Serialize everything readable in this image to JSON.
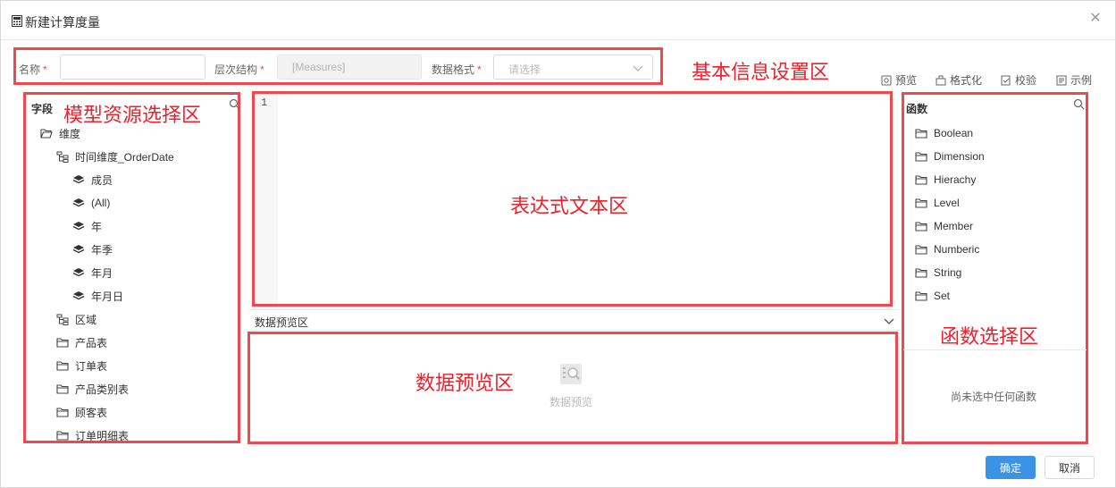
{
  "dialog": {
    "title": "新建计算度量",
    "close_symbol": "✕"
  },
  "form": {
    "name_label": "名称",
    "name_value": "",
    "hierarchy_label": "层次结构",
    "hierarchy_value": "[Measures]",
    "format_label": "数据格式",
    "format_placeholder": "请选择",
    "required_mark": "*"
  },
  "toolbar": {
    "preview": "预览",
    "format": "格式化",
    "validate": "校验",
    "example": "示例"
  },
  "fields": {
    "title": "字段",
    "dimension_folder": "维度",
    "time_dimension": "时间维度_OrderDate",
    "time_levels": [
      "成员",
      "(All)",
      "年",
      "年季",
      "年月",
      "年月日"
    ],
    "region": "区域",
    "tables": [
      "产品表",
      "订单表",
      "产品类别表",
      "顾客表",
      "订单明细表"
    ]
  },
  "editor": {
    "line_number": "1",
    "content": ""
  },
  "preview": {
    "header": "数据预览区",
    "empty_text": "数据预览"
  },
  "functions": {
    "title": "函数",
    "items": [
      "Boolean",
      "Dimension",
      "Hierachy",
      "Level",
      "Member",
      "Numberic",
      "String",
      "Set"
    ],
    "empty_text": "尚未选中任何函数"
  },
  "annotations": {
    "basic_info": "基本信息设置区",
    "model_resources": "模型资源选择区",
    "expression": "表达式文本区",
    "data_preview": "数据预览区",
    "function_select": "函数选择区"
  },
  "buttons": {
    "ok": "确定",
    "cancel": "取消"
  },
  "colors": {
    "annotation_red": "#f0484e",
    "primary_blue": "#3b93e6"
  },
  "icons": {
    "title": "calculator-icon",
    "close": "close-icon",
    "folder": "folder-icon",
    "hierarchy": "hierarchy-icon",
    "level": "layers-icon",
    "search": "search-icon",
    "chevron": "chevron-down-icon",
    "preview_empty": "preview-search-icon"
  }
}
